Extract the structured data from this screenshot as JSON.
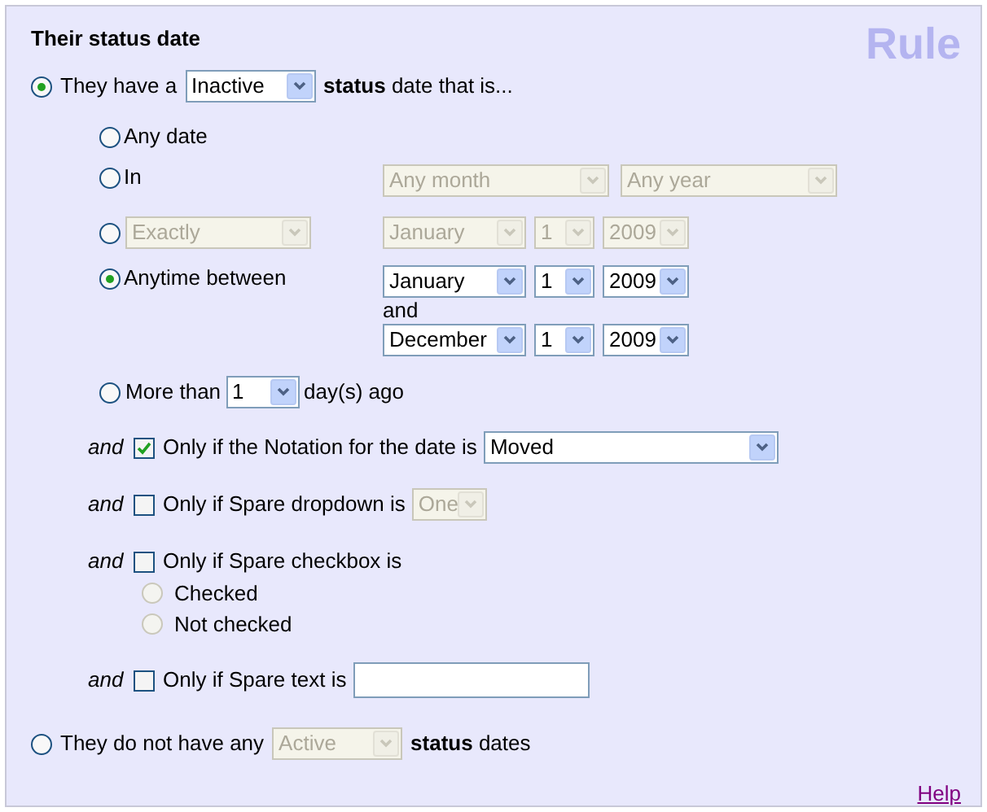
{
  "section_title": "Their status date",
  "badge": "Rule",
  "choices": [
    {
      "kind": "have",
      "selected": true,
      "before": "They have a",
      "status_select": {
        "value": "Inactive",
        "disabled": false
      },
      "after": "**status** date that is...",
      "date_options": [
        {
          "kind": "any",
          "selected": false,
          "label": "Any date"
        },
        {
          "kind": "in",
          "selected": false,
          "label": "In",
          "selects": [
            {
              "value": "Any month",
              "disabled": true
            },
            {
              "value": "Any year",
              "disabled": true
            }
          ]
        },
        {
          "kind": "exactly",
          "selected": false,
          "mode_select": {
            "value": "Exactly",
            "disabled": true
          },
          "selects": [
            {
              "value": "January",
              "disabled": true
            },
            {
              "value": "1",
              "disabled": true
            },
            {
              "value": "2009",
              "disabled": true
            }
          ]
        },
        {
          "kind": "between",
          "selected": true,
          "label": "Anytime between",
          "from": [
            {
              "value": "January",
              "disabled": false
            },
            {
              "value": "1",
              "disabled": false
            },
            {
              "value": "2009",
              "disabled": false
            }
          ],
          "joiner": "and",
          "to": [
            {
              "value": "December",
              "disabled": false
            },
            {
              "value": "1",
              "disabled": false
            },
            {
              "value": "2009",
              "disabled": false
            }
          ]
        },
        {
          "kind": "more_than",
          "selected": false,
          "label": "More than",
          "select": {
            "value": "1",
            "disabled": false
          },
          "after": "day(s) ago"
        }
      ],
      "conditions": [
        {
          "kind": "select",
          "joiner": "and",
          "checked": true,
          "label": "Only if the Notation for the date is",
          "select": {
            "value": "Moved",
            "disabled": false
          }
        },
        {
          "kind": "select",
          "joiner": "and",
          "checked": false,
          "label": "Only if Spare dropdown is",
          "select": {
            "value": "One",
            "disabled": true
          }
        },
        {
          "kind": "radios",
          "joiner": "and",
          "checked": false,
          "label": "Only if Spare checkbox is",
          "options": [
            {
              "label": "Checked",
              "selected": false,
              "disabled": true
            },
            {
              "label": "Not checked",
              "selected": false,
              "disabled": true
            }
          ]
        },
        {
          "kind": "text",
          "joiner": "and",
          "checked": false,
          "label": "Only if Spare text is"
        }
      ]
    },
    {
      "kind": "not_have",
      "selected": false,
      "before": "They do not have any",
      "status_select": {
        "value": "Active",
        "disabled": true
      },
      "after": "**status** dates"
    }
  ],
  "help_link": "Help"
}
